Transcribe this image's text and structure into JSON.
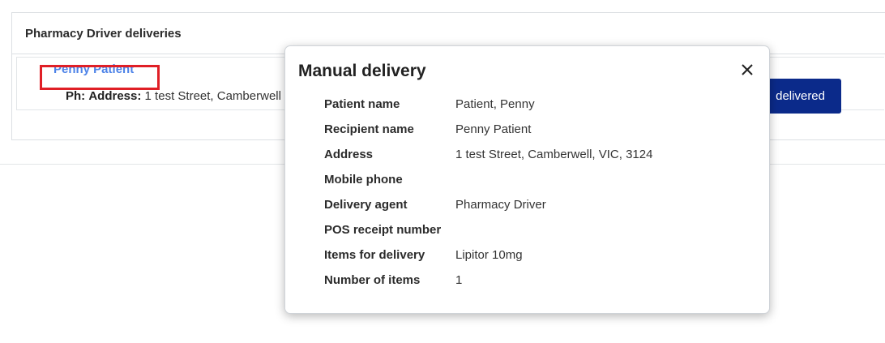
{
  "background": {
    "panel_title": "Pharmacy Driver deliveries",
    "patient_link": "Penny Patient",
    "phone_label": "Ph:",
    "address_label": "Address:",
    "address_value": "1 test Street, Camberwell",
    "delivered_button": "delivered"
  },
  "modal": {
    "title": "Manual delivery",
    "close_icon": "close-icon",
    "details": [
      {
        "label": "Patient name",
        "value": "Patient, Penny"
      },
      {
        "label": "Recipient name",
        "value": "Penny Patient"
      },
      {
        "label": "Address",
        "value": "1 test Street, Camberwell, VIC, 3124"
      },
      {
        "label": "Mobile phone",
        "value": ""
      },
      {
        "label": "Delivery agent",
        "value": "Pharmacy Driver"
      },
      {
        "label": "POS receipt number",
        "value": ""
      },
      {
        "label": "Items for delivery",
        "value": "Lipitor 10mg"
      },
      {
        "label": "Number of items",
        "value": "1"
      }
    ]
  },
  "colors": {
    "link": "#4d83e8",
    "highlight": "#e01f26",
    "primary_button": "#0b2a8a"
  }
}
